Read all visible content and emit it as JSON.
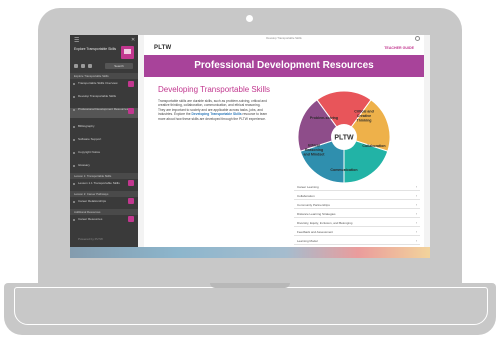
{
  "sidebar": {
    "title": "Explore Transportable Skills",
    "search_label": "Search",
    "sections": [
      "Explore Transportable Skills",
      "Lesson 1: Transportable Skills",
      "Lesson 2: Career Pathways",
      "Additional Resources"
    ],
    "items": [
      "Transportable Skills Overview",
      "Develop Transportable Skills",
      "Professional Development Resources",
      "Bibliography",
      "Software Support",
      "Copyright Notice",
      "Glossary",
      "Lesson 1.1 Transportable Skills",
      "Career Relationships",
      "Career Resources"
    ],
    "footer": "Powered by PLTW"
  },
  "doc": {
    "topbar": "Develop Transportable Skills",
    "logo": "PLTW",
    "guide_label": "TEACHER GUIDE",
    "banner_title": "Professional Development Resources",
    "subheading": "Developing Transportable Skills",
    "paragraph_before": "Transportable skills are durable skills, such as problem-solving, critical and creative thinking, collaboration, communication, and ethical reasoning. They are important to society and are applicable across tasks, jobs, and industries. Explore the",
    "paragraph_link": "Developing Transportable Skills",
    "paragraph_after": "resource to learn more about how these skills are developed through the PLTW experience.",
    "wheel": {
      "center": "PLTW",
      "segments": [
        "Problem-solving",
        "Critical and Creative Thinking",
        "Collaboration",
        "Communication",
        "Ethical Reasoning and Mindset"
      ],
      "colors": [
        "#e8555a",
        "#eeb14a",
        "#22b3a6",
        "#2f8fae",
        "#8e4d8a"
      ]
    },
    "topics": [
      "Career Learning",
      "Collaboration",
      "Community Partnerships",
      "Distance Learning Strategies",
      "Diversity, Equity, Inclusion, and Belonging",
      "Feedback and Assessment",
      "Learning Model"
    ]
  }
}
